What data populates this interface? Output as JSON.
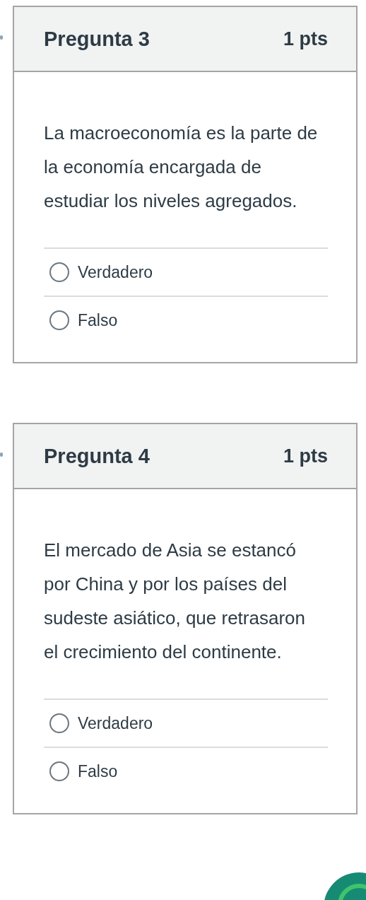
{
  "questions": [
    {
      "title": "Pregunta 3",
      "points": "1 pts",
      "text": "La macroeconomía es la parte de la economía encargada de estudiar los niveles agregados.",
      "options": [
        {
          "label": "Verdadero",
          "selected": false
        },
        {
          "label": "Falso",
          "selected": false
        }
      ]
    },
    {
      "title": "Pregunta 4",
      "points": "1 pts",
      "text": "El mercado de Asia se estancó por China y por los países del sudeste asiático, que retrasaron el crecimiento del continente.",
      "options": [
        {
          "label": "Verdadero",
          "selected": false
        },
        {
          "label": "Falso",
          "selected": false
        }
      ]
    }
  ]
}
